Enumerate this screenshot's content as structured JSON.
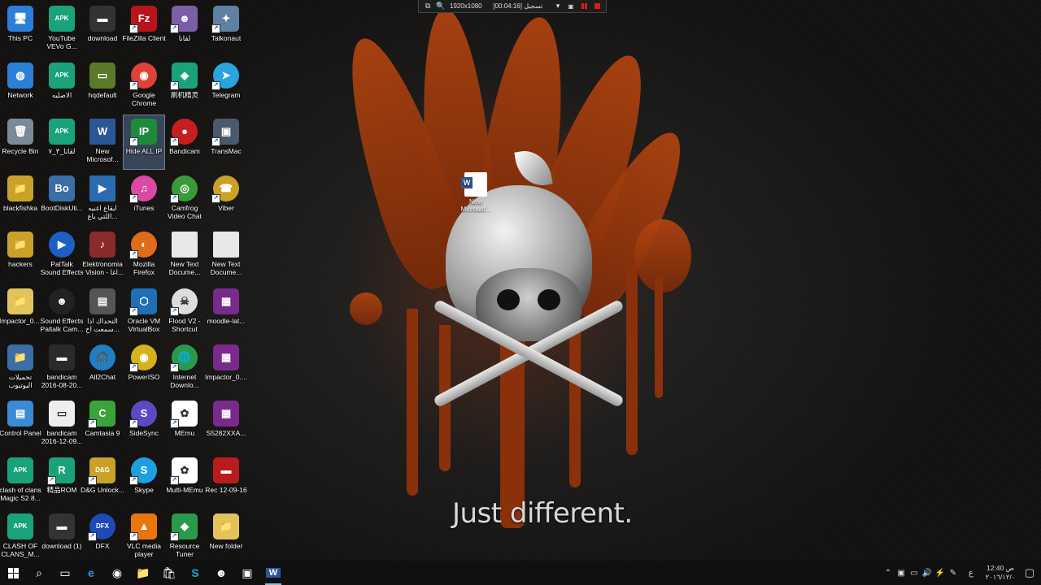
{
  "recorder_bar": {
    "resolution": "1920x1080",
    "status": "تسجيل [00:04:16]"
  },
  "wallpaper": {
    "tagline": "Just different.",
    "file_label": "New Microsof..."
  },
  "desktop_icons": [
    {
      "label": "This PC",
      "color": "#2c7fd6",
      "glyph": "🖥",
      "col": 0,
      "row": 0
    },
    {
      "label": "YouTube VEVo G...",
      "color": "#1aa37a",
      "glyph": "APK",
      "col": 1,
      "row": 0,
      "shortcut": false
    },
    {
      "label": "download",
      "color": "#333333",
      "glyph": "▬",
      "col": 2,
      "row": 0
    },
    {
      "label": "FileZilla Client",
      "color": "#b8141b",
      "glyph": "Fz",
      "col": 3,
      "row": 0,
      "shortcut": true
    },
    {
      "label": "لقانا",
      "color": "#7b5fa6",
      "glyph": "☻",
      "col": 4,
      "row": 0,
      "shortcut": true
    },
    {
      "label": "Talkonaut",
      "color": "#5f7fa3",
      "glyph": "✦",
      "col": 5,
      "row": 0,
      "shortcut": true
    },
    {
      "label": "Network",
      "color": "#2c7fd6",
      "glyph": "◍",
      "col": 0,
      "row": 1
    },
    {
      "label": "الاصليه",
      "color": "#1aa37a",
      "glyph": "APK",
      "col": 1,
      "row": 1
    },
    {
      "label": "hqdefault",
      "color": "#5a7a2a",
      "glyph": "▭",
      "col": 2,
      "row": 1
    },
    {
      "label": "Google Chrome",
      "color": "#db4437",
      "glyph": "◉",
      "col": 3,
      "row": 1,
      "round": true,
      "shortcut": true
    },
    {
      "label": "刷机精灵",
      "color": "#1aa37a",
      "glyph": "◈",
      "col": 4,
      "row": 1,
      "shortcut": true
    },
    {
      "label": "Telegram",
      "color": "#2aa3df",
      "glyph": "➤",
      "col": 5,
      "row": 1,
      "round": true,
      "shortcut": true
    },
    {
      "label": "Recycle Bin",
      "color": "#7a8a96",
      "glyph": "🗑",
      "col": 0,
      "row": 2
    },
    {
      "label": "لقانا_٣_٧",
      "color": "#1aa37a",
      "glyph": "APK",
      "col": 1,
      "row": 2
    },
    {
      "label": "New Microsof...",
      "color": "#2b5797",
      "glyph": "W",
      "col": 2,
      "row": 2,
      "doc": true
    },
    {
      "label": "Hide ALL IP",
      "color": "#1f8a3a",
      "glyph": "IP",
      "col": 3,
      "row": 2,
      "selected": true,
      "shortcut": true
    },
    {
      "label": "Bandicam",
      "color": "#c41e1e",
      "glyph": "●",
      "col": 4,
      "row": 2,
      "round": true,
      "shortcut": true
    },
    {
      "label": "TransMac",
      "color": "#4a5a6a",
      "glyph": "▣",
      "col": 5,
      "row": 2,
      "shortcut": true
    },
    {
      "label": "blackfishka",
      "color": "#c9a227",
      "glyph": "📁",
      "col": 0,
      "row": 3
    },
    {
      "label": "BootDiskUti...",
      "color": "#3a6ea5",
      "glyph": "Bo",
      "col": 1,
      "row": 3
    },
    {
      "label": "ايقاع اغنيه اللتي ياع...",
      "color": "#2b6cb0",
      "glyph": "▶",
      "col": 2,
      "row": 3,
      "doc": true
    },
    {
      "label": "iTunes",
      "color": "#d94aa0",
      "glyph": "♫",
      "col": 3,
      "row": 3,
      "round": true,
      "shortcut": true
    },
    {
      "label": "Camfrog Video Chat",
      "color": "#3a9a3a",
      "glyph": "◎",
      "col": 4,
      "row": 3,
      "round": true,
      "shortcut": true
    },
    {
      "label": "Viber",
      "color": "#c9a227",
      "glyph": "☎",
      "col": 5,
      "row": 3,
      "round": true,
      "shortcut": true
    },
    {
      "label": "hackers",
      "color": "#c9a227",
      "glyph": "📁",
      "col": 0,
      "row": 4
    },
    {
      "label": "PalTalk Sound Effects",
      "color": "#1e5fc4",
      "glyph": "▶",
      "col": 1,
      "row": 4,
      "round": true
    },
    {
      "label": "Elektronomia - Vision - اغا...",
      "color": "#8a2a2a",
      "glyph": "♪",
      "col": 2,
      "row": 4
    },
    {
      "label": "Mozilla Firefox",
      "color": "#e06b1b",
      "glyph": "◐",
      "col": 3,
      "row": 4,
      "round": true,
      "shortcut": true
    },
    {
      "label": "New Text Docume...",
      "color": "#e8e8e8",
      "glyph": "",
      "col": 4,
      "row": 4,
      "doc": true
    },
    {
      "label": "New Text Docume...",
      "color": "#e8e8e8",
      "glyph": "",
      "col": 5,
      "row": 4,
      "doc": true
    },
    {
      "label": "Impactor_0....",
      "color": "#e2c45a",
      "glyph": "📁",
      "col": 0,
      "row": 5
    },
    {
      "label": "Sound Effects Paltalk Cam...",
      "color": "#222222",
      "glyph": "☻",
      "col": 1,
      "row": 5,
      "round": true
    },
    {
      "label": "التحداك اذا سمعت اخ...",
      "color": "#555555",
      "glyph": "▤",
      "col": 2,
      "row": 5
    },
    {
      "label": "Oracle VM VirtualBox",
      "color": "#1e6fb5",
      "glyph": "⬡",
      "col": 3,
      "row": 5,
      "shortcut": true
    },
    {
      "label": "Flood V2 - Shortcut",
      "color": "#dddddd",
      "glyph": "☠",
      "col": 4,
      "row": 5,
      "round": true,
      "shortcut": true
    },
    {
      "label": "moodle-lat...",
      "color": "#7a2a8a",
      "glyph": "▦",
      "col": 5,
      "row": 5
    },
    {
      "label": "تحميلات اليوتيوب",
      "color": "#3a6ea5",
      "glyph": "📁",
      "col": 0,
      "row": 6
    },
    {
      "label": "bandicam 2016-08-20...",
      "color": "#2a2a2a",
      "glyph": "▬",
      "col": 1,
      "row": 6
    },
    {
      "label": "All2Chat",
      "color": "#1e7fc4",
      "glyph": "🎧",
      "col": 2,
      "row": 6,
      "round": true
    },
    {
      "label": "PowerISO",
      "color": "#d4b21e",
      "glyph": "◉",
      "col": 3,
      "row": 6,
      "round": true,
      "shortcut": true
    },
    {
      "label": "Internet Downlo...",
      "color": "#2a9a4a",
      "glyph": "🌐",
      "col": 4,
      "row": 6,
      "round": true,
      "shortcut": true
    },
    {
      "label": "Impactor_0....",
      "color": "#7a2a8a",
      "glyph": "▦",
      "col": 5,
      "row": 6
    },
    {
      "label": "Control Panel",
      "color": "#3a8ad6",
      "glyph": "▤",
      "col": 0,
      "row": 7
    },
    {
      "label": "bandicam 2016-12-09...",
      "color": "#eeeeee",
      "glyph": "▭",
      "col": 1,
      "row": 7
    },
    {
      "label": "Camtasia 9",
      "color": "#3aa33a",
      "glyph": "C",
      "col": 2,
      "row": 7,
      "shortcut": true
    },
    {
      "label": "SideSync",
      "color": "#5a4ac4",
      "glyph": "S",
      "col": 3,
      "row": 7,
      "round": true,
      "shortcut": true
    },
    {
      "label": "MEmu",
      "color": "#ffffff",
      "glyph": "✿",
      "col": 4,
      "row": 7,
      "shortcut": true
    },
    {
      "label": "S5282XXA...",
      "color": "#7a2a8a",
      "glyph": "▦",
      "col": 5,
      "row": 7
    },
    {
      "label": "clash of clans Magic S2 8...",
      "color": "#1aa37a",
      "glyph": "APK",
      "col": 0,
      "row": 8
    },
    {
      "label": "精品ROM",
      "color": "#1aa37a",
      "glyph": "R",
      "col": 1,
      "row": 8,
      "shortcut": true
    },
    {
      "label": "D&G Unlock...",
      "color": "#c9a227",
      "glyph": "D&G",
      "col": 2,
      "row": 8,
      "shortcut": true
    },
    {
      "label": "Skype",
      "color": "#1ea0e0",
      "glyph": "S",
      "col": 3,
      "row": 8,
      "round": true,
      "shortcut": true
    },
    {
      "label": "Multi-MEmu",
      "color": "#ffffff",
      "glyph": "✿",
      "col": 4,
      "row": 8,
      "shortcut": true
    },
    {
      "label": "Rec 12-09-16",
      "color": "#b81c1c",
      "glyph": "▬",
      "col": 5,
      "row": 8
    },
    {
      "label": "CLASH OF CLANS_M...",
      "color": "#1aa37a",
      "glyph": "APK",
      "col": 0,
      "row": 9
    },
    {
      "label": "download (1)",
      "color": "#333333",
      "glyph": "▬",
      "col": 1,
      "row": 9
    },
    {
      "label": "DFX",
      "color": "#1e4ab5",
      "glyph": "DFX",
      "col": 2,
      "row": 9,
      "round": true,
      "shortcut": true
    },
    {
      "label": "VLC media player",
      "color": "#e8760e",
      "glyph": "▲",
      "col": 3,
      "row": 9,
      "shortcut": true
    },
    {
      "label": "Resource Tuner",
      "color": "#2a9a4a",
      "glyph": "◆",
      "col": 4,
      "row": 9,
      "shortcut": true
    },
    {
      "label": "New folder",
      "color": "#e2c45a",
      "glyph": "📁",
      "col": 5,
      "row": 9
    }
  ],
  "taskbar": {
    "search_icon": "search-icon",
    "pinned": [
      {
        "name": "task-view",
        "glyph": "▭"
      },
      {
        "name": "edge",
        "glyph": "e"
      },
      {
        "name": "chrome",
        "glyph": "◉"
      },
      {
        "name": "file-explorer",
        "glyph": "📁"
      },
      {
        "name": "store",
        "glyph": "🛍"
      },
      {
        "name": "skype",
        "glyph": "S"
      },
      {
        "name": "lqana",
        "glyph": "☻"
      },
      {
        "name": "bandicam-folder",
        "glyph": "▣"
      },
      {
        "name": "word",
        "glyph": "W",
        "active": true
      }
    ],
    "tray": {
      "language": "ع",
      "time": "12:40 ص",
      "date": "٢٠١٦/١٢/٠"
    }
  }
}
